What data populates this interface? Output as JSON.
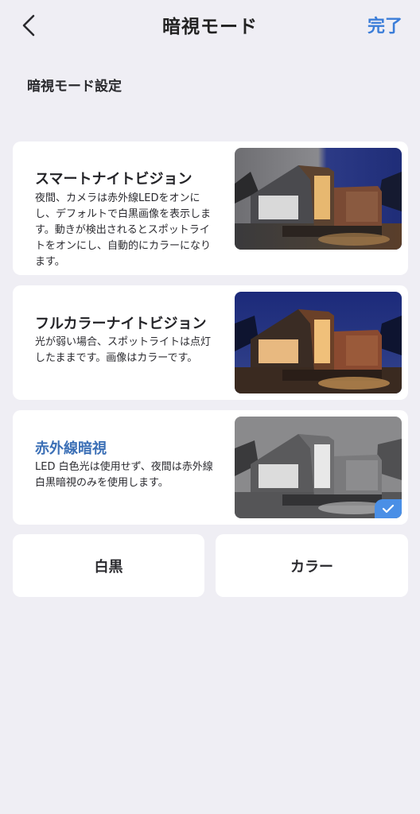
{
  "header": {
    "title": "暗視モード",
    "done_label": "完了",
    "back_icon": "chevron-left-icon"
  },
  "section": {
    "label": "暗視モード設定"
  },
  "options": [
    {
      "title": "スマートナイトビジョン",
      "description": "夜間、カメラは赤外線LEDをオンにし、デフォルトで白黒画像を表示します。動きが検出されるとスポットライトをオンにし、自動的にカラーになります。",
      "selected": false
    },
    {
      "title": "フルカラーナイトビジョン",
      "description": "光が弱い場合、スポットライトは点灯したままです。画像はカラーです。",
      "selected": false
    },
    {
      "title": "赤外線暗視",
      "description": "LED 白色光は使用せず、夜間は赤外線白黒暗視のみを使用します。",
      "selected": true
    }
  ],
  "buttons": {
    "bw_label": "白黒",
    "color_label": "カラー"
  },
  "colors": {
    "accent": "#3b7dd8",
    "selected_title": "#3b6fb6",
    "check_badge": "#4a8fe6",
    "background": "#efeef4"
  }
}
